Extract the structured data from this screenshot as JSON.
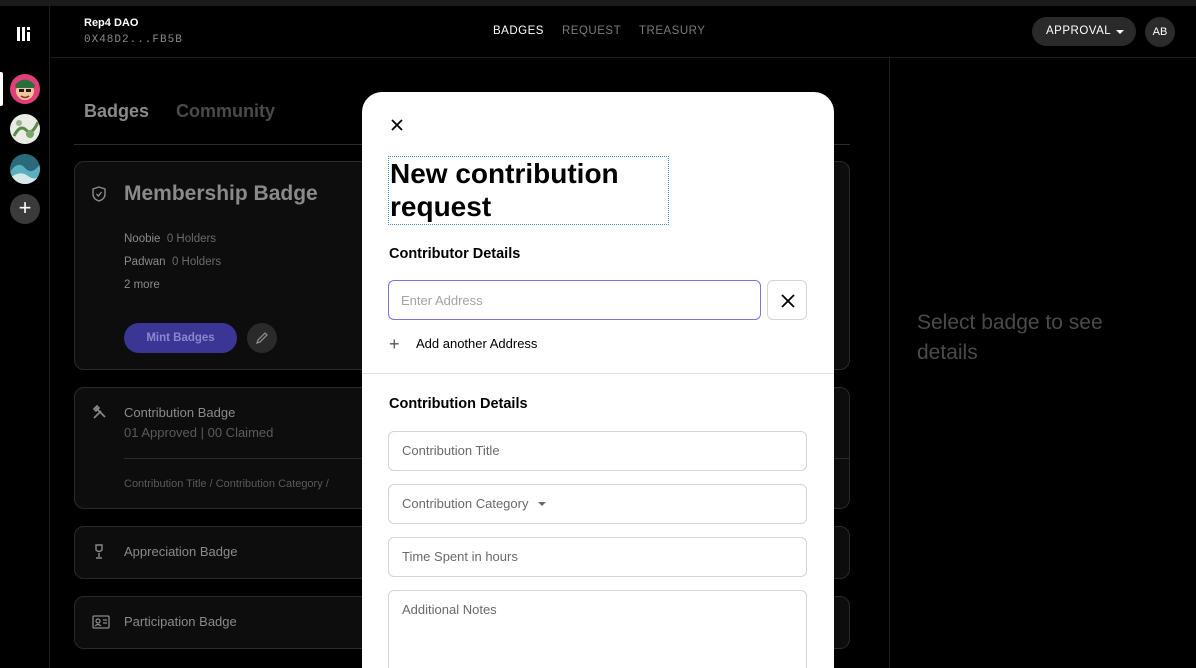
{
  "app": {
    "dao_name": "Rep4 DAO",
    "dao_address": "0X48D2...FB5B",
    "nav": [
      {
        "label": "BADGES",
        "active": true
      },
      {
        "label": "REQUEST",
        "active": false
      },
      {
        "label": "TREASURY",
        "active": false
      }
    ],
    "approval_label": "APPROVAL",
    "user_initials": "AB",
    "add_dao_symbol": "+"
  },
  "main": {
    "tabs": [
      "Badges",
      "Community"
    ],
    "membership": {
      "title": "Membership Badge",
      "levels": [
        {
          "name": "Noobie",
          "holders": "0 Holders"
        },
        {
          "name": "Padwan",
          "holders": "0 Holders"
        }
      ],
      "more": "2 more",
      "mint_label": "Mint Badges"
    },
    "contribution": {
      "title": "Contribution Badge",
      "stats": "01 Approved | 00 Claimed",
      "breadcrumb": "Contribution Title / Contribution Category /"
    },
    "appreciation": {
      "title": "Appreciation Badge"
    },
    "participation": {
      "title": "Participation Badge"
    }
  },
  "right_panel": {
    "message": "Select badge to see details"
  },
  "modal": {
    "title": "New contribution request",
    "contributor_section": "Contributor Details",
    "address_placeholder": "Enter Address",
    "add_another": "Add another Address",
    "contribution_section": "Contribution Details",
    "fields": {
      "title": "Contribution Title",
      "category": "Contribution Category",
      "time": "Time Spent in hours",
      "notes": "Additional Notes"
    }
  },
  "colors": {
    "accent": "#3b3596",
    "focus_border": "#7a74d8",
    "background": "#000000"
  }
}
